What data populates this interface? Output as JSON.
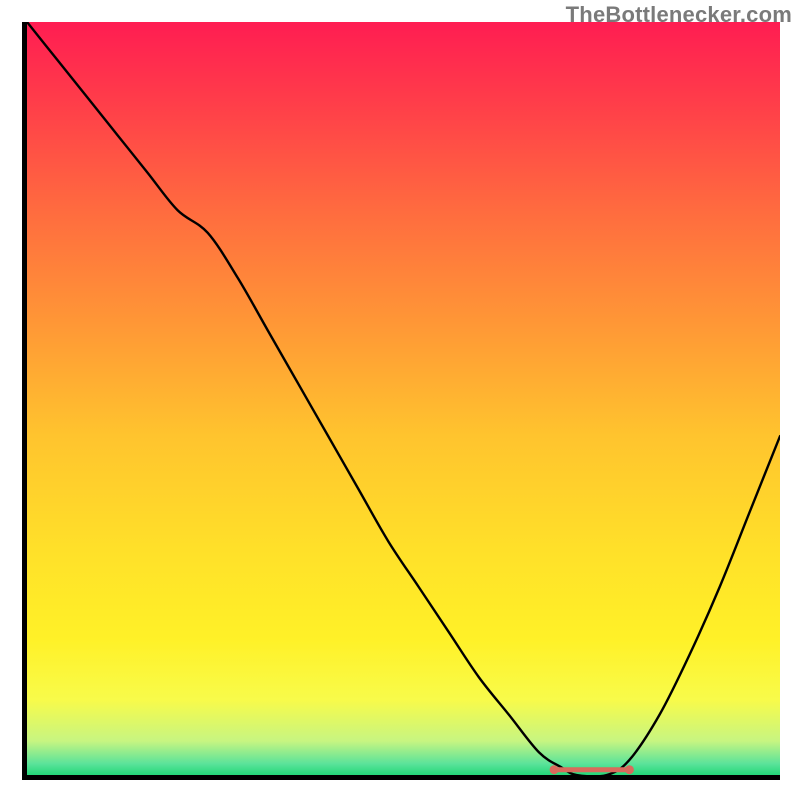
{
  "watermark": "TheBottlenecker.com",
  "chart_data": {
    "type": "line",
    "title": "",
    "xlabel": "",
    "ylabel": "",
    "xlim": [
      0,
      100
    ],
    "ylim": [
      0,
      100
    ],
    "background_gradient": {
      "stops": [
        {
          "offset": 0.0,
          "color": "#ff1d52"
        },
        {
          "offset": 0.1,
          "color": "#ff3b4a"
        },
        {
          "offset": 0.25,
          "color": "#ff6b3f"
        },
        {
          "offset": 0.4,
          "color": "#ff9736"
        },
        {
          "offset": 0.55,
          "color": "#ffc42e"
        },
        {
          "offset": 0.7,
          "color": "#ffe029"
        },
        {
          "offset": 0.82,
          "color": "#fff128"
        },
        {
          "offset": 0.9,
          "color": "#f8fb4a"
        },
        {
          "offset": 0.955,
          "color": "#c7f581"
        },
        {
          "offset": 0.985,
          "color": "#5be39a"
        },
        {
          "offset": 1.0,
          "color": "#24d879"
        }
      ]
    },
    "series": [
      {
        "name": "bottleneck-curve",
        "color": "#000000",
        "width": 2.4,
        "x": [
          0,
          4,
          8,
          12,
          16,
          20,
          24,
          28,
          32,
          36,
          40,
          44,
          48,
          52,
          56,
          60,
          64,
          68,
          71,
          73,
          77,
          80,
          84,
          88,
          92,
          96,
          100
        ],
        "y": [
          100,
          95,
          90,
          85,
          80,
          75,
          72,
          66,
          59,
          52,
          45,
          38,
          31,
          25,
          19,
          13,
          8,
          3,
          1,
          0,
          0,
          2,
          8,
          16,
          25,
          35,
          45
        ]
      }
    ],
    "marker": {
      "name": "optimal-range-marker",
      "color": "#d96a5c",
      "x_start": 70,
      "x_end": 80,
      "y": 0.7,
      "thickness": 5,
      "endcap_radius": 4.5
    }
  }
}
